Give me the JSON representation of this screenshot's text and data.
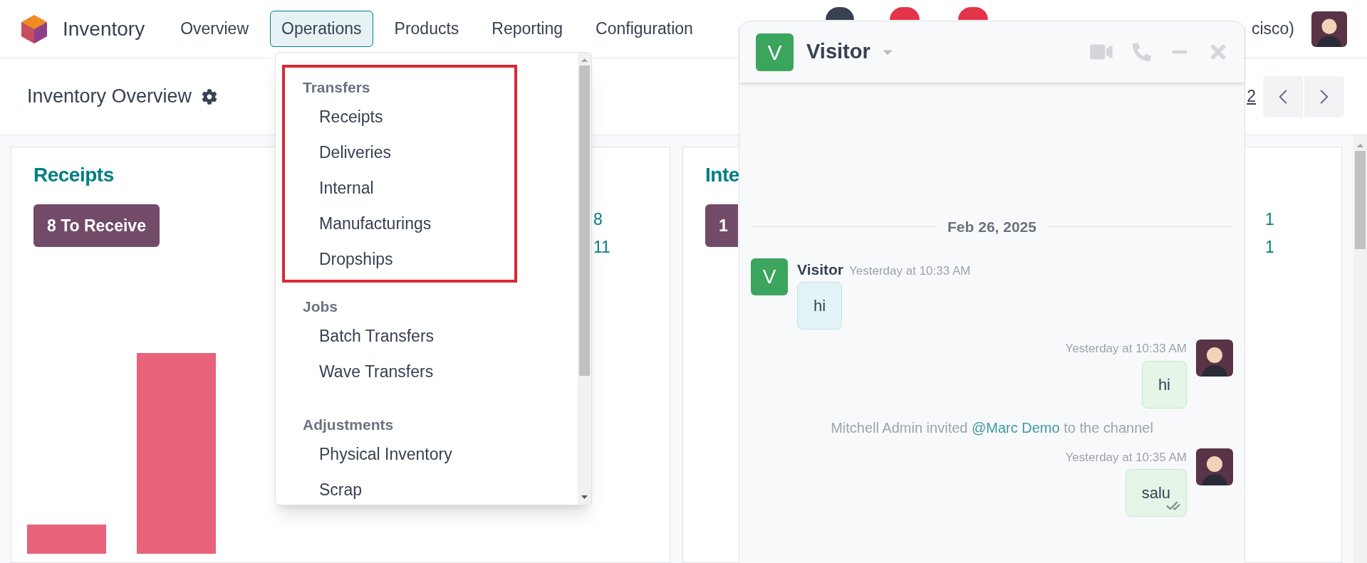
{
  "app": {
    "name": "Inventory"
  },
  "menu": [
    {
      "label": "Overview",
      "selected": false
    },
    {
      "label": "Operations",
      "selected": true
    },
    {
      "label": "Products",
      "selected": false
    },
    {
      "label": "Reporting",
      "selected": false
    },
    {
      "label": "Configuration",
      "selected": false
    }
  ],
  "systray": {
    "company": "cisco)"
  },
  "control_panel": {
    "title": "Inventory Overview",
    "pager": "2"
  },
  "operations_menu": {
    "sections": [
      {
        "title": "Transfers",
        "highlighted": true,
        "items": [
          "Receipts",
          "Deliveries",
          "Internal",
          "Manufacturings",
          "Dropships"
        ]
      },
      {
        "title": "Jobs",
        "highlighted": false,
        "items": [
          "Batch Transfers",
          "Wave Transfers"
        ]
      },
      {
        "title": "Adjustments",
        "highlighted": false,
        "items": [
          "Physical Inventory",
          "Scrap"
        ]
      }
    ]
  },
  "cards": [
    {
      "title": "Receipts",
      "button": "8 To Receive",
      "counts": [
        "8",
        "11"
      ],
      "chart": true
    },
    {
      "title": "Inte",
      "button": "1",
      "counts": [
        "1",
        "1"
      ],
      "chart": false
    }
  ],
  "chat": {
    "name": "Visitor",
    "avatar_letter": "V",
    "date": "Feb 26, 2025",
    "messages": [
      {
        "kind": "incoming",
        "author": "Visitor",
        "avatar_letter": "V",
        "time": "Yesterday at 10:33 AM",
        "text": "hi"
      },
      {
        "kind": "outgoing",
        "time": "Yesterday at 10:33 AM",
        "text": "hi",
        "seen": false
      },
      {
        "kind": "notification",
        "text": "Mitchell Admin invited",
        "mention": "@Marc Demo",
        "suffix": "to the channel"
      },
      {
        "kind": "outgoing",
        "time": "Yesterday at 10:35 AM",
        "text": "salu",
        "seen": true
      }
    ]
  }
}
